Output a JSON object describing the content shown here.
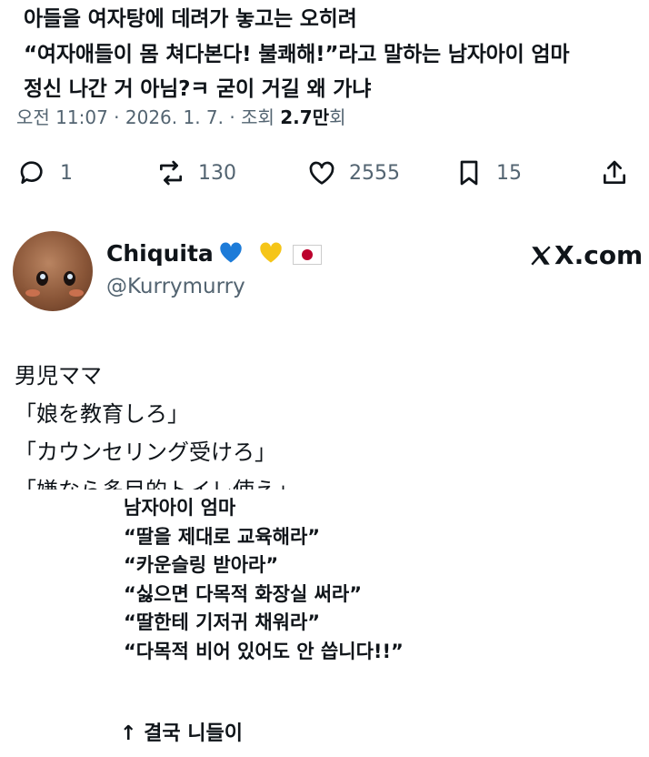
{
  "tweet": {
    "lines": [
      "아들을 여자탕에 데려가 놓고는 오히려",
      "“여자애들이 몸 쳐다본다! 불쾌해!”라고 말하는 남자아이 엄마",
      "정신 나간 거 아님?ㅋ 굳이 거길 왜 가냐"
    ],
    "meta": {
      "time": "오전 11:07",
      "date": "2026. 1. 7.",
      "views_label": "조회",
      "views_count": "2.7만",
      "views_suffix": "회"
    },
    "actions": {
      "replies": "1",
      "reposts": "130",
      "likes": "2555",
      "bookmarks": "15"
    }
  },
  "quoted": {
    "display_name": "Chiquita",
    "handle": "@Kurrymurry",
    "source": "X.com",
    "icons": [
      "blue-heart-icon",
      "yellow-heart-icon",
      "japan-flag-icon"
    ],
    "colors": {
      "blue_heart": "#1d7bd8",
      "yellow_heart": "#f5c518"
    },
    "lines": [
      "男児ママ",
      "「娘を教育しろ」",
      "「カウンセリング受けろ」"
    ],
    "cut_line": "「嫌なら多目的トイレ使え」"
  },
  "translation": {
    "lines": [
      "남자아이 엄마",
      "“딸을 제대로 교육해라”",
      "“카운슬링 받아라”",
      "“싫으면 다목적 화장실 써라”",
      "“딸한테 기저귀 채워라”",
      "“다목적 비어 있어도 안 씁니다!!”"
    ],
    "footer": "↑ 결국 니들이"
  }
}
